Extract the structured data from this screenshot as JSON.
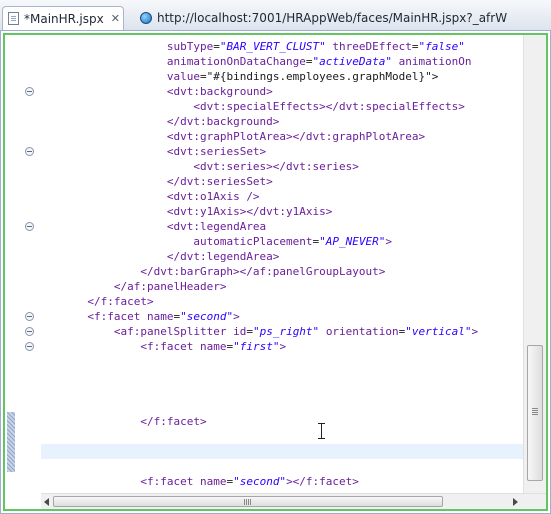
{
  "tabs": [
    {
      "label": "*MainHR.jspx",
      "icon": "jspx-file-icon",
      "close": "✕"
    },
    {
      "label": "http://localhost:7001/HRAppWeb/faces/MainHR.jspx?_afrW",
      "icon": "globe-icon"
    }
  ],
  "colors": {
    "tag": "#6a1f9a",
    "value": "#2a00ff",
    "current_line": "#e8f2fe",
    "editor_focus_border": "#62c462"
  },
  "code_lines": [
    {
      "fold": false,
      "tokens": [
        {
          "k": "plain",
          "t": "                   "
        },
        {
          "k": "attr",
          "t": "subType"
        },
        {
          "k": "plain",
          "t": "="
        },
        {
          "k": "val",
          "t": "\"BAR_VERT_CLUST\""
        },
        {
          "k": "plain",
          "t": " "
        },
        {
          "k": "attr",
          "t": "threeDEffect"
        },
        {
          "k": "plain",
          "t": "="
        },
        {
          "k": "val",
          "t": "\"false\""
        }
      ]
    },
    {
      "fold": false,
      "tokens": [
        {
          "k": "plain",
          "t": "                   "
        },
        {
          "k": "attr",
          "t": "animationOnDataChange"
        },
        {
          "k": "plain",
          "t": "="
        },
        {
          "k": "val",
          "t": "\"activeData\""
        },
        {
          "k": "plain",
          "t": " "
        },
        {
          "k": "attr",
          "t": "animationOn"
        }
      ]
    },
    {
      "fold": false,
      "tokens": [
        {
          "k": "plain",
          "t": "                   "
        },
        {
          "k": "attr",
          "t": "value"
        },
        {
          "k": "plain",
          "t": "=\"#{bindings.employees.graphModel}\">"
        }
      ]
    },
    {
      "fold": true,
      "tokens": [
        {
          "k": "plain",
          "t": "                   "
        },
        {
          "k": "tag",
          "t": "<dvt:background>"
        }
      ]
    },
    {
      "fold": false,
      "tokens": [
        {
          "k": "plain",
          "t": "                       "
        },
        {
          "k": "tag",
          "t": "<dvt:specialEffects></dvt:specialEffects>"
        }
      ]
    },
    {
      "fold": false,
      "tokens": [
        {
          "k": "plain",
          "t": "                   "
        },
        {
          "k": "tag",
          "t": "</dvt:background>"
        }
      ]
    },
    {
      "fold": false,
      "tokens": [
        {
          "k": "plain",
          "t": "                   "
        },
        {
          "k": "tag",
          "t": "<dvt:graphPlotArea></dvt:graphPlotArea>"
        }
      ]
    },
    {
      "fold": true,
      "tokens": [
        {
          "k": "plain",
          "t": "                   "
        },
        {
          "k": "tag",
          "t": "<dvt:seriesSet>"
        }
      ]
    },
    {
      "fold": false,
      "tokens": [
        {
          "k": "plain",
          "t": "                       "
        },
        {
          "k": "tag",
          "t": "<dvt:series></dvt:series>"
        }
      ]
    },
    {
      "fold": false,
      "tokens": [
        {
          "k": "plain",
          "t": "                   "
        },
        {
          "k": "tag",
          "t": "</dvt:seriesSet>"
        }
      ]
    },
    {
      "fold": false,
      "tokens": [
        {
          "k": "plain",
          "t": "                   "
        },
        {
          "k": "tag",
          "t": "<dvt:o1Axis />"
        }
      ]
    },
    {
      "fold": false,
      "tokens": [
        {
          "k": "plain",
          "t": "                   "
        },
        {
          "k": "tag",
          "t": "<dvt:y1Axis></dvt:y1Axis>"
        }
      ]
    },
    {
      "fold": true,
      "tokens": [
        {
          "k": "plain",
          "t": "                   "
        },
        {
          "k": "tag",
          "t": "<dvt:legendArea"
        }
      ]
    },
    {
      "fold": false,
      "tokens": [
        {
          "k": "plain",
          "t": "                       "
        },
        {
          "k": "attr",
          "t": "automaticPlacement"
        },
        {
          "k": "plain",
          "t": "="
        },
        {
          "k": "val",
          "t": "\"AP_NEVER\""
        },
        {
          "k": "tag",
          "t": ">"
        }
      ]
    },
    {
      "fold": false,
      "tokens": [
        {
          "k": "plain",
          "t": "                   "
        },
        {
          "k": "tag",
          "t": "</dvt:legendArea>"
        }
      ]
    },
    {
      "fold": false,
      "tokens": [
        {
          "k": "plain",
          "t": "               "
        },
        {
          "k": "tag",
          "t": "</dvt:barGraph></af:panelGroupLayout>"
        }
      ]
    },
    {
      "fold": false,
      "tokens": [
        {
          "k": "plain",
          "t": "           "
        },
        {
          "k": "tag",
          "t": "</af:panelHeader>"
        }
      ]
    },
    {
      "fold": false,
      "tokens": [
        {
          "k": "plain",
          "t": "       "
        },
        {
          "k": "tag",
          "t": "</f:facet>"
        }
      ]
    },
    {
      "fold": true,
      "tokens": [
        {
          "k": "plain",
          "t": "       "
        },
        {
          "k": "tag",
          "t": "<f:facet "
        },
        {
          "k": "attr",
          "t": "name"
        },
        {
          "k": "plain",
          "t": "="
        },
        {
          "k": "val",
          "t": "\"second\""
        },
        {
          "k": "tag",
          "t": ">"
        }
      ]
    },
    {
      "fold": true,
      "tokens": [
        {
          "k": "plain",
          "t": "           "
        },
        {
          "k": "tag",
          "t": "<af:panelSplitter "
        },
        {
          "k": "attr",
          "t": "id"
        },
        {
          "k": "plain",
          "t": "="
        },
        {
          "k": "val",
          "t": "\"ps_right\""
        },
        {
          "k": "plain",
          "t": " "
        },
        {
          "k": "attr",
          "t": "orientation"
        },
        {
          "k": "plain",
          "t": "="
        },
        {
          "k": "val",
          "t": "\"vertical\""
        },
        {
          "k": "tag",
          "t": ">"
        }
      ]
    },
    {
      "fold": true,
      "tokens": [
        {
          "k": "plain",
          "t": "               "
        },
        {
          "k": "tag",
          "t": "<f:facet "
        },
        {
          "k": "attr",
          "t": "name"
        },
        {
          "k": "plain",
          "t": "="
        },
        {
          "k": "val",
          "t": "\"first\""
        },
        {
          "k": "tag",
          "t": ">"
        }
      ]
    },
    {
      "fold": false,
      "tokens": []
    },
    {
      "fold": false,
      "tokens": []
    },
    {
      "fold": false,
      "tokens": []
    },
    {
      "fold": false,
      "tokens": []
    },
    {
      "fold": false,
      "tokens": [
        {
          "k": "plain",
          "t": "               "
        },
        {
          "k": "tag",
          "t": "</f:facet>"
        }
      ]
    },
    {
      "fold": false,
      "tokens": []
    },
    {
      "fold": false,
      "current": true,
      "tokens": []
    },
    {
      "fold": false,
      "tokens": []
    },
    {
      "fold": false,
      "tokens": [
        {
          "k": "plain",
          "t": "               "
        },
        {
          "k": "tag",
          "t": "<f:facet "
        },
        {
          "k": "attr",
          "t": "name"
        },
        {
          "k": "plain",
          "t": "="
        },
        {
          "k": "val",
          "t": "\"second\""
        },
        {
          "k": "tag",
          "t": "></f:facet>"
        }
      ]
    }
  ]
}
